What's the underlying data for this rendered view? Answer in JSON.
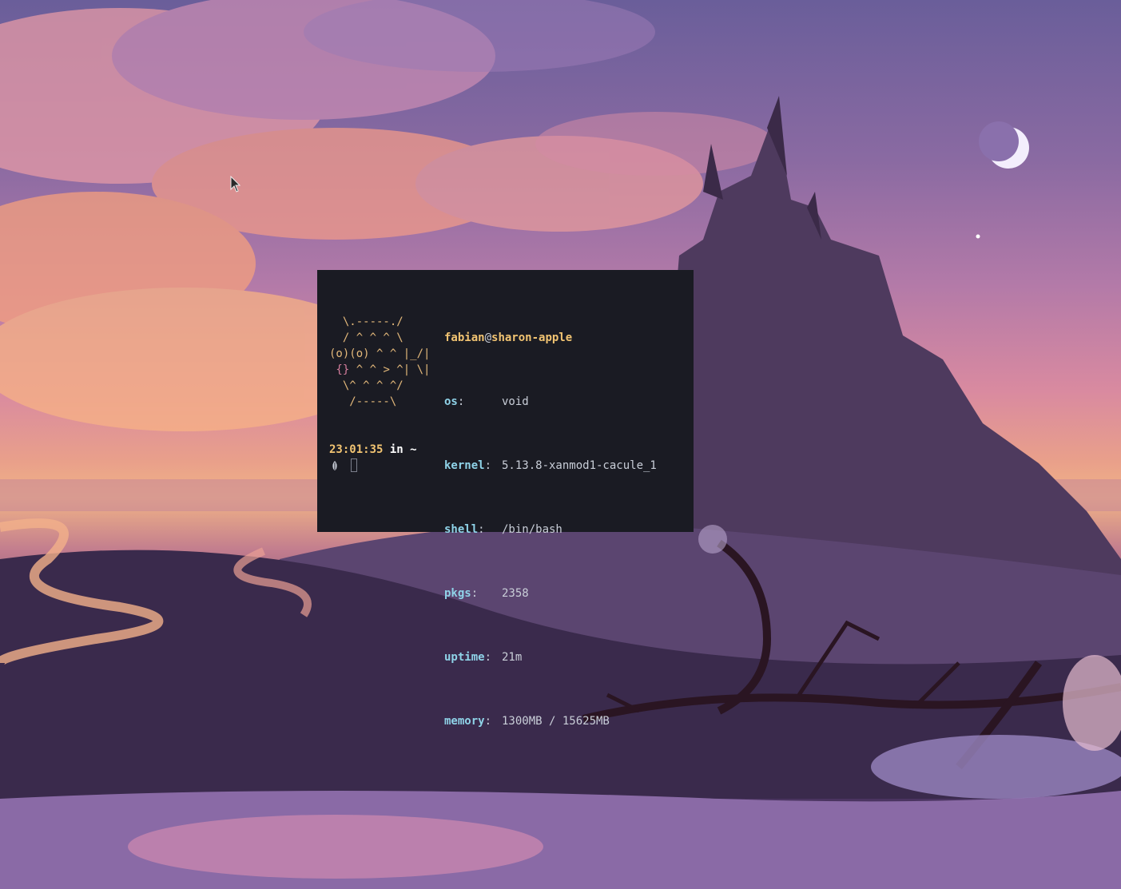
{
  "desktop": {
    "wallpaper_icon": "pixel-art-castle-sunset"
  },
  "terminal": {
    "ascii_art": {
      "line1": "  \\.-----./",
      "line2": "  / ^ ^ ^ \\",
      "line3": "(o)(o) ^ ^ |_/|",
      "line4_brace": " {}",
      "line4_rest": " ^ ^ > ^| \\|",
      "line5": "  \\^ ^ ^ ^/",
      "line6": "   /-----\\"
    },
    "user": "fabian",
    "at": "@",
    "host": "sharon-apple",
    "fields": [
      {
        "key": "os",
        "value": "void"
      },
      {
        "key": "kernel",
        "value": "5.13.8-xanmod1-cacule_1"
      },
      {
        "key": "shell",
        "value": "/bin/bash"
      },
      {
        "key": "pkgs",
        "value": "2358"
      },
      {
        "key": "uptime",
        "value": "21m"
      },
      {
        "key": "memory",
        "value": "1300MB / 15625MB"
      }
    ],
    "colon": ":",
    "prompt": {
      "time": "23:01:35",
      "in": "in",
      "cwd": "~"
    },
    "prompt_icon": "leaf-icon"
  },
  "colors": {
    "terminal_bg": "#1a1b23",
    "accent_yellow": "#f2c472",
    "accent_cyan": "#8fd3e8",
    "ascii_orange": "#e3b87a",
    "ascii_pink": "#d47d9c"
  }
}
